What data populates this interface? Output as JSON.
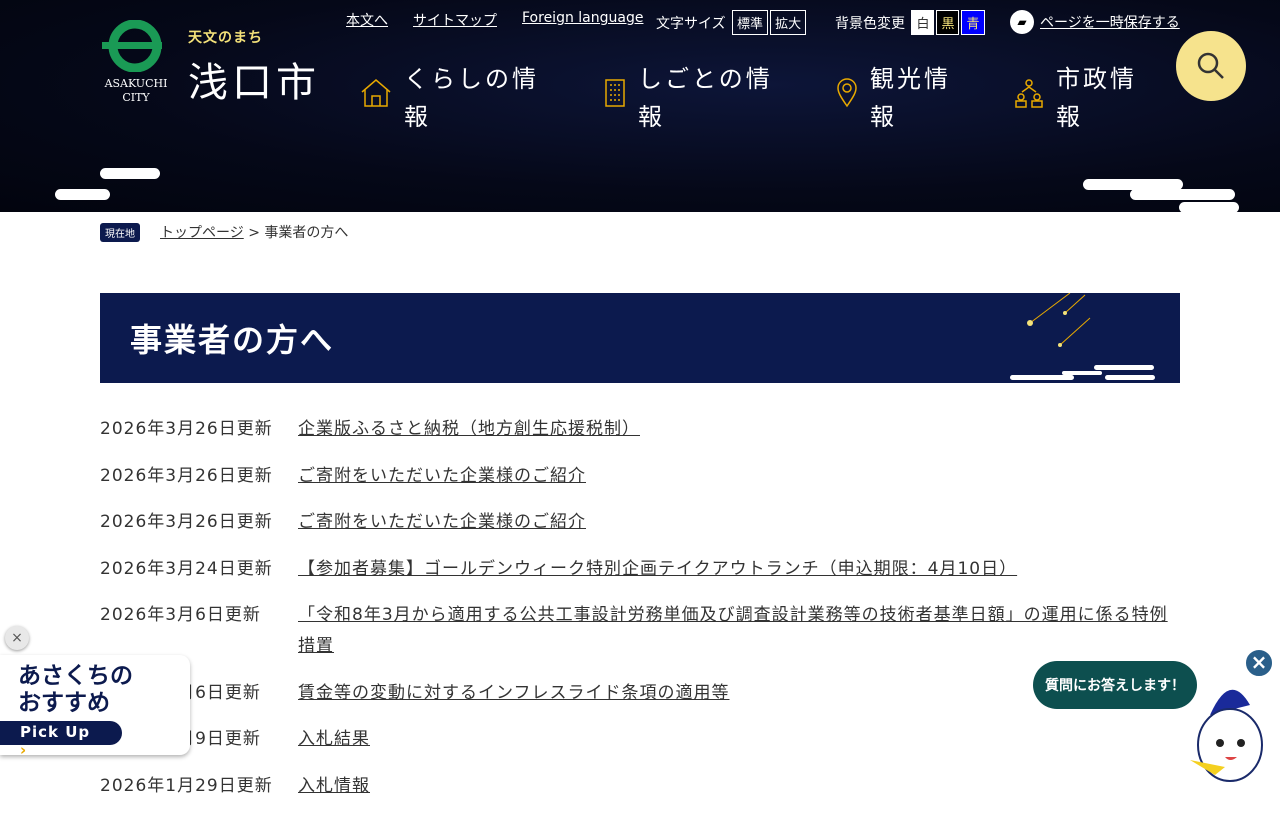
{
  "header": {
    "logo_en": "ASAKUCHI CITY",
    "logo_sub": "天文のまち",
    "logo_jp": "浅口市",
    "links": [
      "本文へ",
      "サイトマップ",
      "Foreign language"
    ],
    "font_size_label": "文字サイズ",
    "font_sizes": [
      "標準",
      "拡大"
    ],
    "bg_label": "背景色変更",
    "bg_options": [
      "白",
      "黒",
      "青"
    ],
    "save_page": "ページを一時保存する",
    "nav": [
      "くらしの情報",
      "しごとの情報",
      "観光情報",
      "市政情報"
    ]
  },
  "breadcrumb": {
    "here": "現在地",
    "top": "トップページ",
    "sep": ">",
    "current": "事業者の方へ"
  },
  "page_title": "事業者の方へ",
  "items": [
    {
      "date": "2026年3月26日更新",
      "title": "企業版ふるさと納税（地方創生応援税制）"
    },
    {
      "date": "2026年3月26日更新",
      "title": "ご寄附をいただいた企業様のご紹介"
    },
    {
      "date": "2026年3月26日更新",
      "title": "ご寄附をいただいた企業様のご紹介"
    },
    {
      "date": "2026年3月24日更新",
      "title": "【参加者募集】ゴールデンウィーク特別企画テイクアウトランチ（申込期限：4月10日）"
    },
    {
      "date": "2026年3月6日更新",
      "title": "「令和8年3月から適用する公共工事設計労務単価及び調査設計業務等の技術者基準日額」の運用に係る特例措置"
    },
    {
      "date": "2026年3月6日更新",
      "title": "賃金等の変動に対するインフレスライド条項の適用等"
    },
    {
      "date": "2026年2月9日更新",
      "title": "入札結果"
    },
    {
      "date": "2026年1月29日更新",
      "title": "入札情報"
    }
  ],
  "pickup": {
    "line1": "あさくちの",
    "line2": "おすすめ",
    "button": "Pick Up",
    "close": "×"
  },
  "chat": {
    "bubble": "質問にお答えします！",
    "close": "×"
  }
}
